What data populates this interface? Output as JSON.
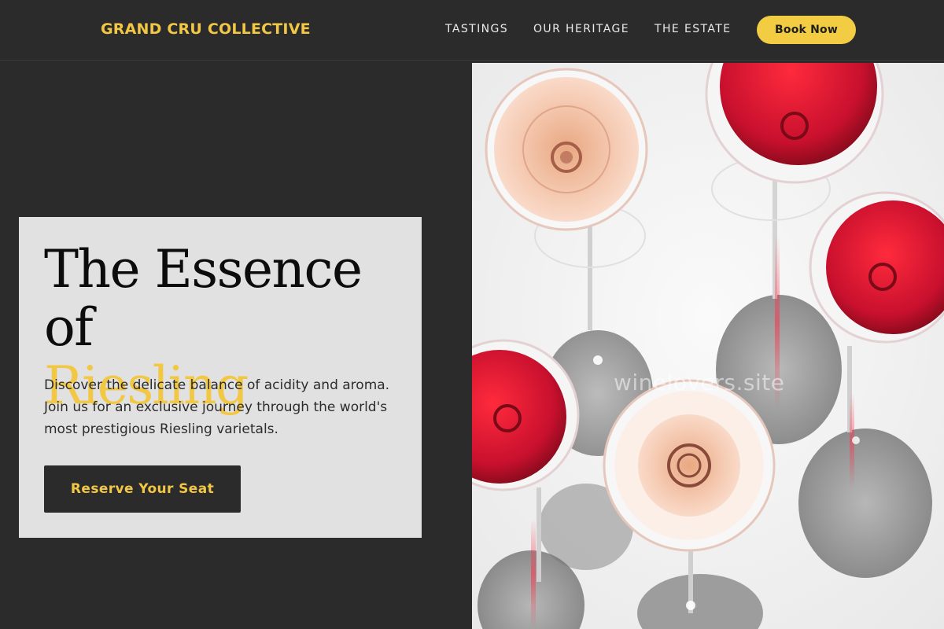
{
  "header": {
    "brand": "GRAND CRU COLLECTIVE",
    "nav": [
      "TASTINGS",
      "OUR HERITAGE",
      "THE ESTATE"
    ],
    "book_label": "Book Now"
  },
  "hero": {
    "title_line1": "The Essence of",
    "title_accent": "Riesling",
    "description": "Discover the delicate balance of acidity and aroma. Join us for an exclusive journey through the world's most prestigious Riesling varietals.",
    "cta_label": "Reserve Your Seat"
  },
  "photo": {
    "watermark": "winelovers.site"
  },
  "colors": {
    "background": "#2b2b2b",
    "accent": "#f2c744",
    "card": "#e1e1e1",
    "red_wine": "#c8102e",
    "rose_wine": "#f0b9a0"
  }
}
